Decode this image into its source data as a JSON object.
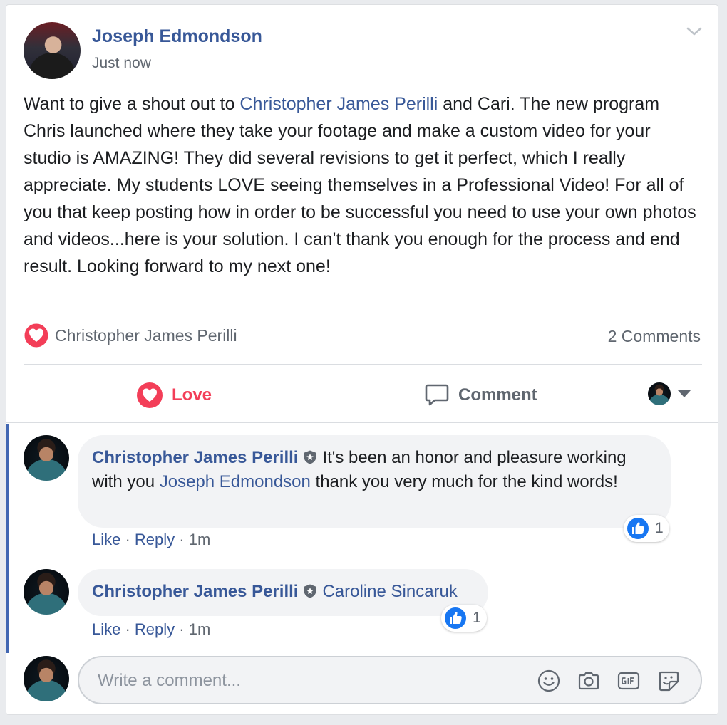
{
  "post": {
    "author": "Joseph Edmondson",
    "timestamp": "Just now",
    "text": {
      "part1": "Want to give a shout out to ",
      "mention": "Christopher James Perilli",
      "part2": " and Cari. The new program Chris launched where they take your footage and make a custom video for your studio is AMAZING! They did several revisions to get it perfect, which I really appreciate. My students LOVE seeing themselves in a Professional Video! For all of you that keep posting how in order to be successful you need to use your own photos and videos...here is your solution. I can't thank you enough for the process and end result. Looking forward to my next one!"
    },
    "reactions": {
      "type_icon": "heart-icon",
      "names": "Christopher James Perilli"
    },
    "comment_count": "2 Comments"
  },
  "actions": {
    "love_label": "Love",
    "comment_label": "Comment"
  },
  "comments": [
    {
      "author": "Christopher James Perilli",
      "text_before": "It's been an honor and pleasure working with you ",
      "mention": "Joseph Edmondson",
      "text_after": " thank you very much for the kind words!",
      "like_count": "1",
      "like_label": "Like",
      "reply_label": "Reply",
      "time": "1m"
    },
    {
      "author": "Christopher James Perilli",
      "mention": "Caroline Sincaruk",
      "like_count": "1",
      "like_label": "Like",
      "reply_label": "Reply",
      "time": "1m"
    }
  ],
  "composer": {
    "placeholder": "Write a comment...",
    "icons": [
      "emoji-icon",
      "camera-icon",
      "gif-icon",
      "sticker-icon"
    ]
  },
  "colors": {
    "link": "#385898",
    "love": "#f33e58",
    "like": "#1877f2",
    "secondary_text": "#606770",
    "bubble": "#f2f3f5",
    "rail": "#4267b2"
  },
  "separator": " · "
}
